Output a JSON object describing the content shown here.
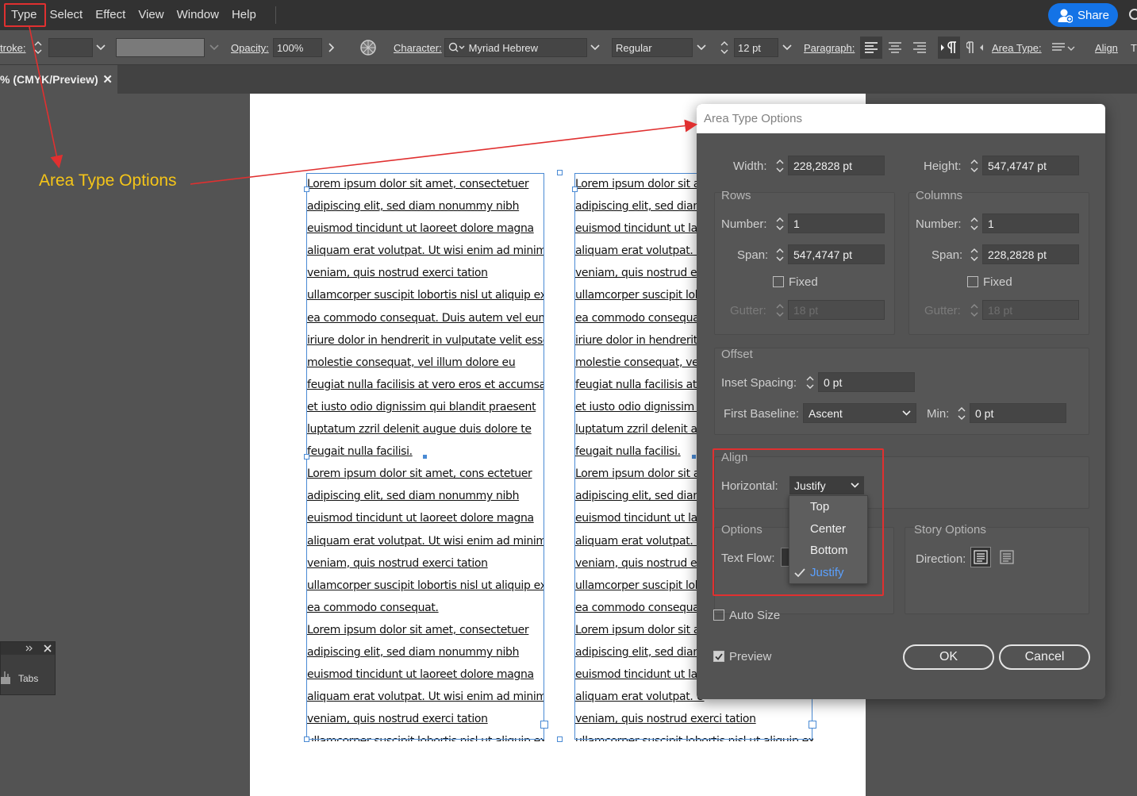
{
  "menu": {
    "items": [
      "Type",
      "Select",
      "Effect",
      "View",
      "Window",
      "Help"
    ],
    "share_label": "Share"
  },
  "control_bar": {
    "stroke_label": "troke:",
    "opacity_label": "Opacity:",
    "opacity_value": "100%",
    "character_label": "Character:",
    "font_family": "Myriad Hebrew",
    "font_style": "Regular",
    "font_size": "12 pt",
    "paragraph_label": "Paragraph:",
    "area_type_label": "Area Type:",
    "align_label": "Align"
  },
  "document_tab": {
    "title": "% (CMYK/Preview)",
    "close_glyph": "✕"
  },
  "annotation": {
    "label": "Area Type Options",
    "color": "#f5c518",
    "arrow_color": "#e03030"
  },
  "text_columns": {
    "left": [
      "Lorem ipsum dolor sit amet, consectetuer",
      "adipiscing elit, sed diam nonummy nibh",
      "euismod tincidunt ut laoreet dolore magna",
      "aliquam erat volutpat. Ut wisi enim ad minim",
      "veniam, quis nostrud exerci tation",
      "ullamcorper suscipit lobortis nisl ut aliquip ex",
      "ea commodo consequat. Duis autem vel eum",
      "iriure dolor in hendrerit in vulputate velit esse",
      "molestie consequat, vel illum dolore eu",
      "feugiat nulla facilisis at vero eros et accumsan",
      "et iusto odio dignissim qui blandit praesent",
      "luptatum zzril delenit augue duis dolore te",
      "feugait nulla facilisi.",
      "Lorem ipsum dolor sit amet, cons ectetuer",
      "adipiscing elit, sed diam nonummy nibh",
      "euismod tincidunt ut laoreet dolore magna",
      "aliquam erat volutpat. Ut wisi enim ad minim",
      "veniam, quis nostrud exerci tation",
      "ullamcorper suscipit lobortis nisl ut aliquip ex",
      "ea commodo consequat.",
      "Lorem ipsum dolor sit amet, consectetuer",
      "adipiscing elit, sed diam nonummy nibh",
      "euismod tincidunt ut laoreet dolore magna",
      "aliquam erat volutpat. Ut wisi enim ad minim",
      "veniam, quis nostrud exerci tation",
      "ullamcorper suscipit lobortis nisl ut aliquip ex"
    ],
    "right": [
      "Lorem ipsum dolor sit a",
      "adipiscing elit, sed diam",
      "euismod tincidunt ut lao",
      "aliquam erat volutpat. U",
      "veniam, quis nostrud ex",
      "ullamcorper suscipit lob",
      "ea commodo consequa",
      "iriure dolor in hendrerit",
      "molestie consequat, vel",
      "feugiat nulla facilisis at v",
      "et iusto odio dignissim q",
      "luptatum zzril delenit au",
      "feugait nulla facilisi.",
      "Lorem ipsum dolor sit a",
      "adipiscing elit, sed diam",
      "euismod tincidunt ut lao",
      "aliquam erat volutpat. U",
      "veniam, quis nostrud ex",
      "ullamcorper suscipit lob",
      "ea commodo consequa",
      "Lorem ipsum dolor sit a",
      "adipiscing elit, sed diam",
      "euismod tincidunt ut lao",
      "aliquam erat volutpat. U",
      "veniam, quis nostrud exerci tation",
      "ullamcorper suscipit lobortis nisl ut aliquip ex"
    ]
  },
  "tabs_panel": {
    "label": "Tabs"
  },
  "dialog": {
    "title": "Area Type Options",
    "width_label": "Width:",
    "width_value": "228,2828 pt",
    "height_label": "Height:",
    "height_value": "547,4747 pt",
    "rows": {
      "title": "Rows",
      "number_label": "Number:",
      "number_value": "1",
      "span_label": "Span:",
      "span_value": "547,4747 pt",
      "fixed_label": "Fixed",
      "gutter_label": "Gutter:",
      "gutter_value": "18 pt"
    },
    "columns": {
      "title": "Columns",
      "number_label": "Number:",
      "number_value": "1",
      "span_label": "Span:",
      "span_value": "228,2828 pt",
      "fixed_label": "Fixed",
      "gutter_label": "Gutter:",
      "gutter_value": "18 pt"
    },
    "offset": {
      "title": "Offset",
      "inset_label": "Inset Spacing:",
      "inset_value": "0 pt",
      "baseline_label": "First Baseline:",
      "baseline_value": "Ascent",
      "min_label": "Min:",
      "min_value": "0 pt"
    },
    "align": {
      "title": "Align",
      "horizontal_label": "Horizontal:",
      "horizontal_value": "Justify",
      "options": [
        "Top",
        "Center",
        "Bottom",
        "Justify"
      ],
      "selected_index": 3
    },
    "options": {
      "title": "Options",
      "text_flow_label": "Text Flow:"
    },
    "story": {
      "title": "Story Options",
      "direction_label": "Direction:"
    },
    "auto_size_label": "Auto Size",
    "preview_label": "Preview",
    "ok_label": "OK",
    "cancel_label": "Cancel"
  }
}
